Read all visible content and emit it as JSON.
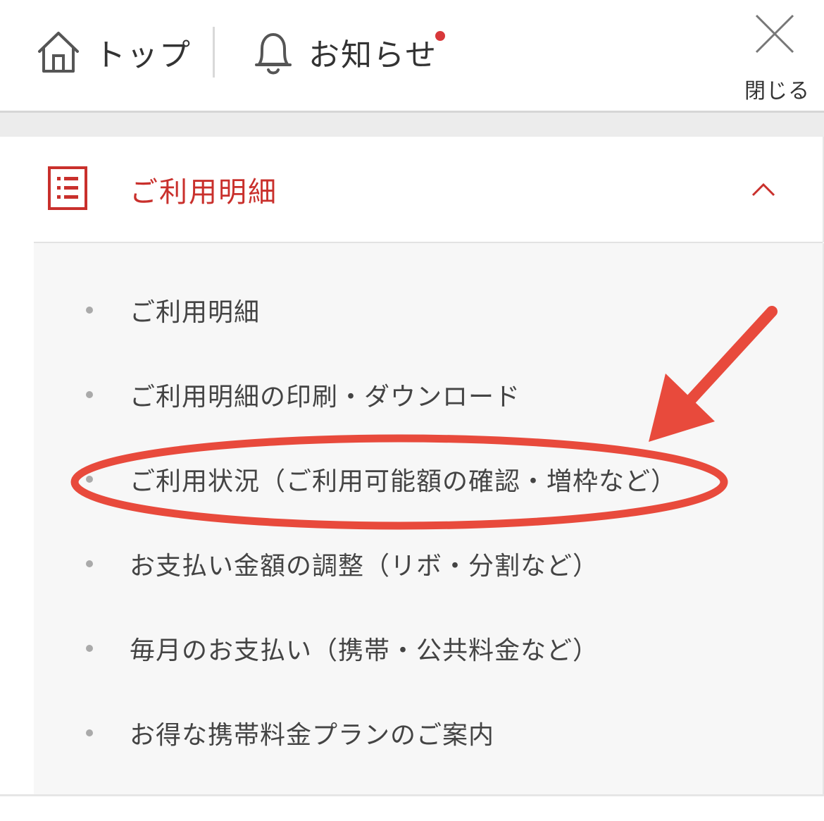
{
  "header": {
    "top_label": "トップ",
    "notice_label": "お知らせ",
    "close_label": "閉じる"
  },
  "menu": {
    "section_title": "ご利用明細",
    "items": [
      {
        "label": "ご利用明細"
      },
      {
        "label": "ご利用明細の印刷・ダウンロード"
      },
      {
        "label": "ご利用状況（ご利用可能額の確認・増枠など）"
      },
      {
        "label": "お支払い金額の調整（リボ・分割など）"
      },
      {
        "label": "毎月のお支払い（携帯・公共料金など）"
      },
      {
        "label": "お得な携帯料金プランのご案内"
      }
    ]
  },
  "colors": {
    "accent": "#c9302c",
    "annotation": "#e84a3c",
    "notice_dot": "#d8383a"
  },
  "icons": [
    "home-icon",
    "bell-icon",
    "close-icon",
    "list-icon",
    "chevron-up-icon"
  ]
}
